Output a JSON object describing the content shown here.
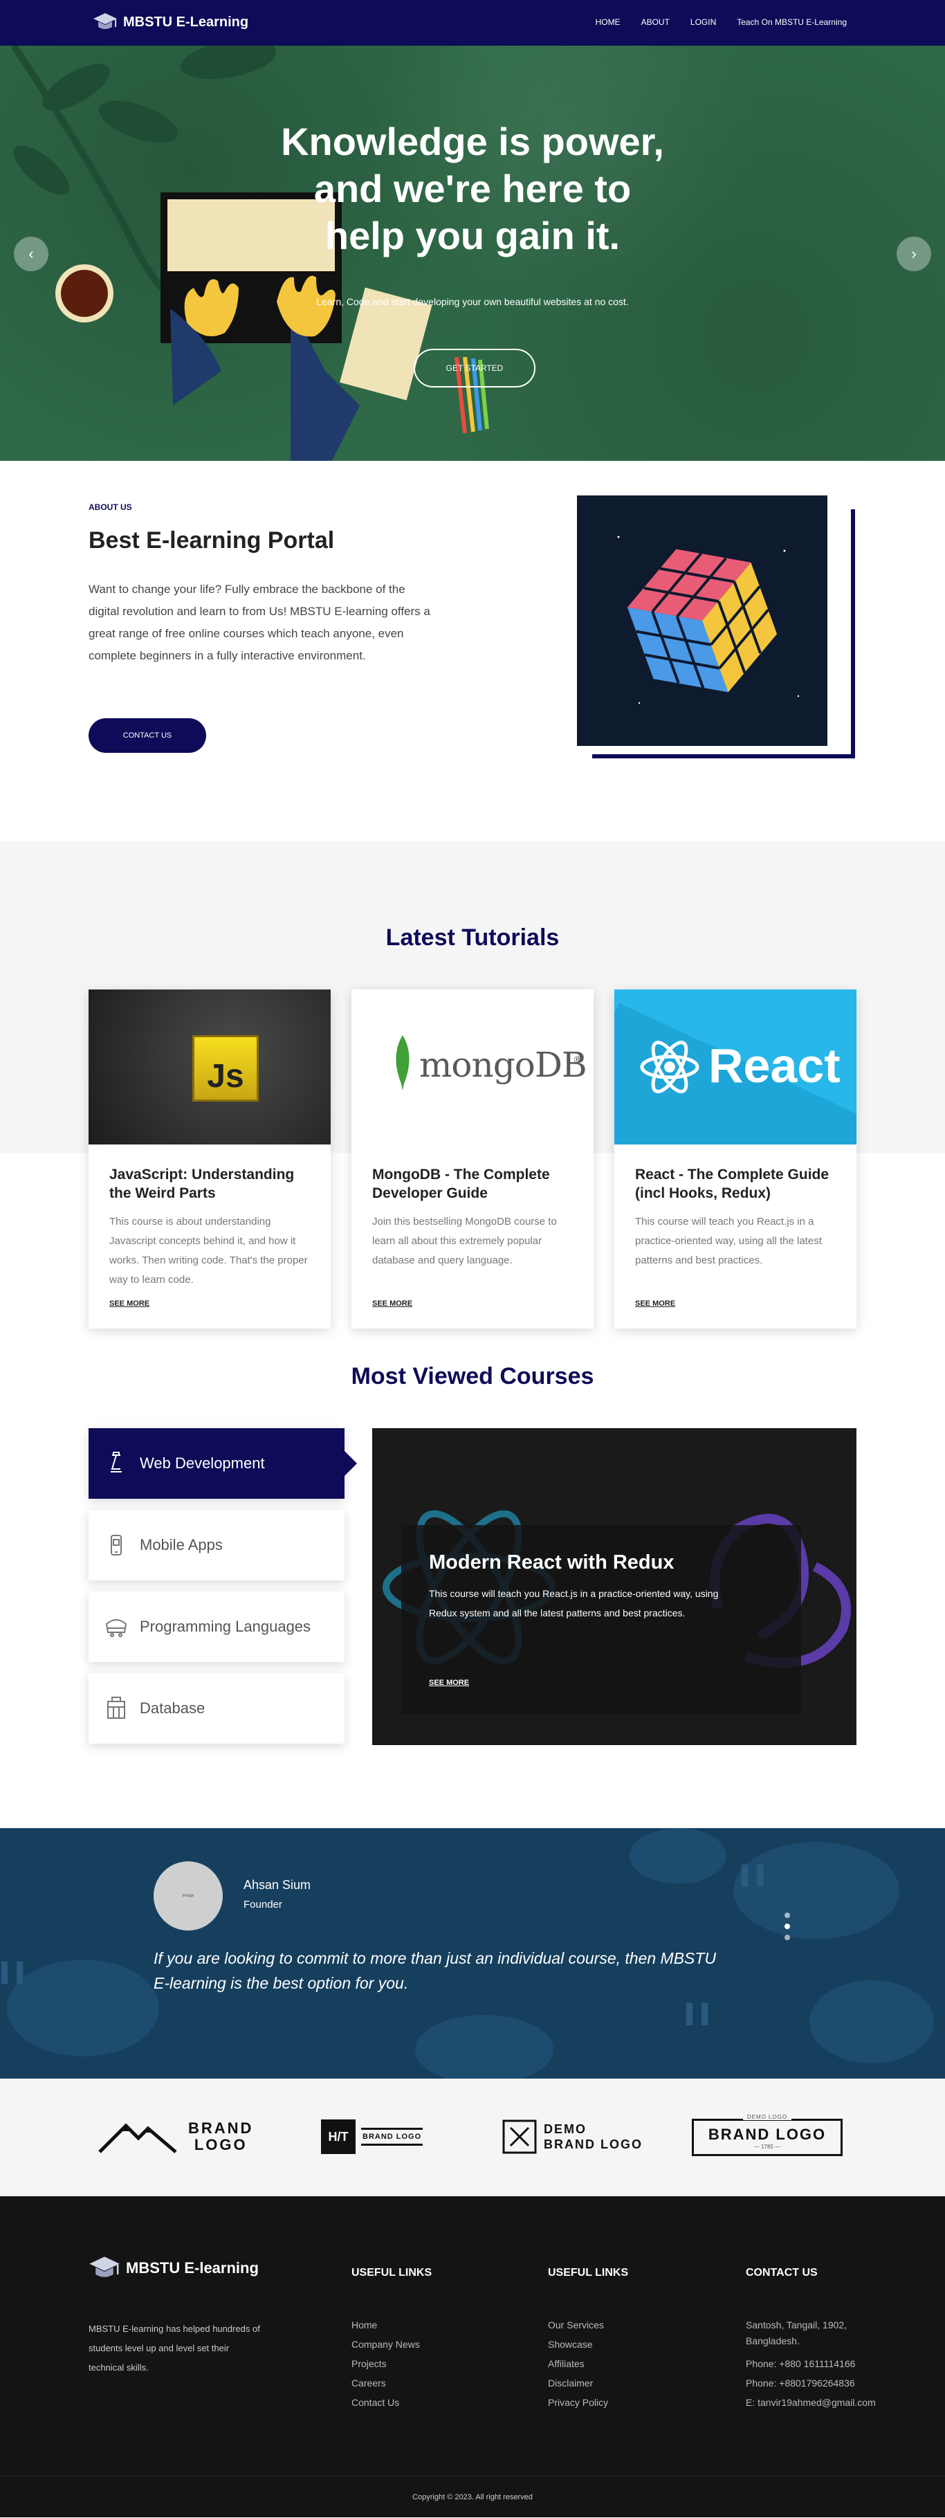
{
  "nav": {
    "brand": "MBSTU E-Learning",
    "links": [
      "HOME",
      "ABOUT",
      "LOGIN",
      "Teach On MBSTU E-Learning"
    ]
  },
  "hero": {
    "headline_1": "Knowledge is power,",
    "headline_2": "and we're here to",
    "headline_3": "help you gain it.",
    "subtitle": "Learn, Code and start developing your own beautiful websites at no cost.",
    "cta": "GET STARTED",
    "prev": "‹",
    "next": "›"
  },
  "about": {
    "eyebrow": "ABOUT US",
    "title": "Best E-learning Portal",
    "text": "Want to change your life? Fully embrace the backbone of the digital revolution and learn to from Us! MBSTU E-learning offers a great range of free online courses which teach anyone, even complete beginners in a fully interactive environment.",
    "button": "CONTACT US"
  },
  "tutorials": {
    "title": "Latest Tutorials",
    "cards": [
      {
        "title": "JavaScript: Understanding the Weird Parts",
        "text": "This course is about understanding Javascript concepts behind it, and how it works. Then writing code. That's the proper way to learn code.",
        "more": "SEE MORE",
        "logo": "Js"
      },
      {
        "title": "MongoDB - The Complete Developer Guide",
        "text": "Join this bestselling MongoDB course to learn all about this extremely popular database and query language.",
        "more": "SEE MORE",
        "logo": "mongoDB",
        "logo_mark": "®"
      },
      {
        "title": "React - The Complete Guide (incl Hooks, Redux)",
        "text": "This course will teach you React.js in a practice-oriented way, using all the latest patterns and best practices.",
        "more": "SEE MORE",
        "logo": "React"
      }
    ]
  },
  "most_viewed": {
    "title": "Most Viewed Courses",
    "tabs": [
      "Web Development",
      "Mobile Apps",
      "Programming Languages",
      "Database"
    ],
    "active_tab": "Web Development",
    "panel": {
      "title": "Modern React with Redux",
      "text": "This course will teach you React.js in a practice-oriented way, using Redux system and all the latest patterns and best practices.",
      "more": "SEE MORE"
    }
  },
  "testimonial": {
    "avatar_text": "image",
    "name": "Ahsan Sium",
    "role": "Founder",
    "quote": "If you are looking to commit to more than just an individual course, then MBSTU E-learning is the best option for you."
  },
  "brands": {
    "b1_line1": "BRAND",
    "b1_line2": "LOGO",
    "b2_mark": "H/T",
    "b2_text": "BRAND LOGO",
    "b3_line1": "DEMO",
    "b3_line2": "BRAND LOGO",
    "b4_top": "DEMO LOGO",
    "b4_main": "BRAND LOGO",
    "b4_year": "— 1785 —"
  },
  "footer": {
    "brand": "MBSTU E-learning",
    "about": "MBSTU E-learning has helped hundreds of students level up and level set their technical skills.",
    "useful_links_title_1": "USEFUL LINKS",
    "links_1": [
      "Home",
      "Company News",
      "Projects",
      "Careers",
      "Contact Us"
    ],
    "useful_links_title_2": "USEFUL LINKS",
    "links_2": [
      "Our Services",
      "Showcase",
      "Affiliates",
      "Disclaimer",
      "Privacy Policy"
    ],
    "contact_title": "CONTACT US",
    "address_1": "Santosh, Tangail, 1902,",
    "address_2": "Bangladesh.",
    "phone_1": "Phone:  +880 1611114166",
    "phone_2": "Phone:  +8801796264836",
    "email": "E:  tanvir19ahmed@gmail.com",
    "copyright": "Copyright © 2023. All right reserved"
  },
  "colors": {
    "primary": "#0e0b58",
    "hero_green": "#2f6a48",
    "testimonial_blue": "#163f5e",
    "footer": "#141414"
  }
}
